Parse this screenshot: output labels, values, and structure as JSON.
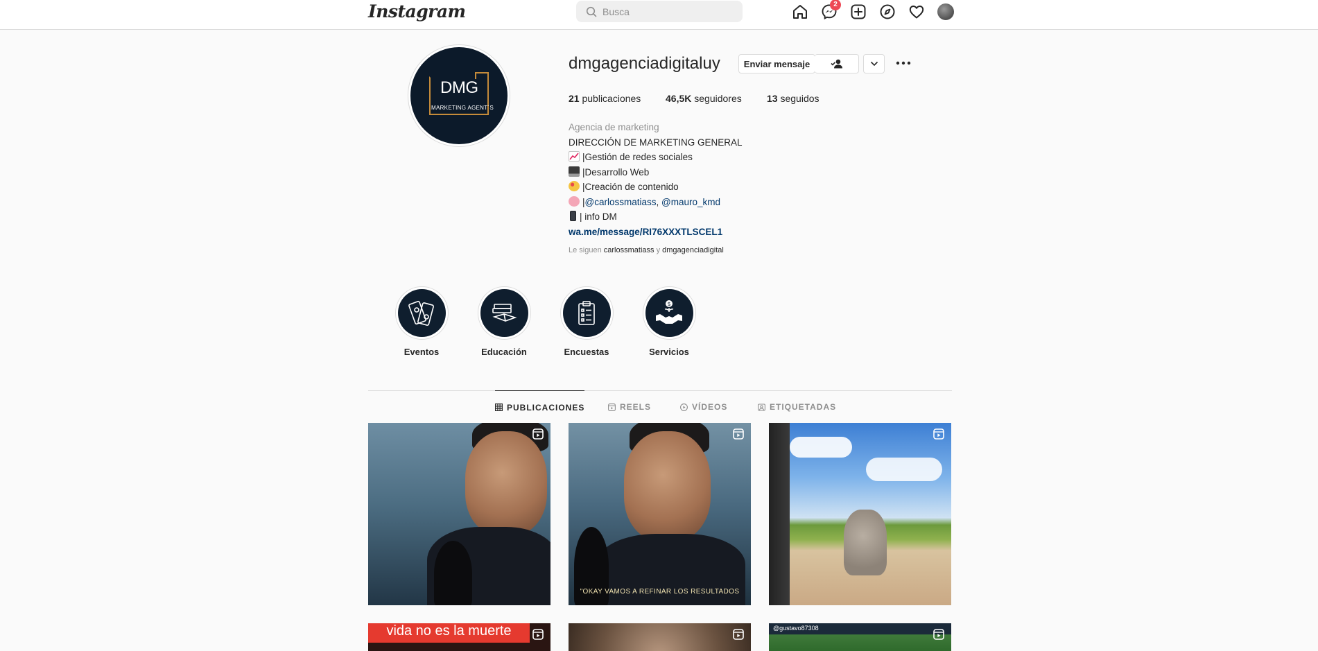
{
  "nav": {
    "logo": "Instagram",
    "search_placeholder": "Busca",
    "messenger_badge": "2"
  },
  "profile": {
    "username": "dmgagenciadigitaluy",
    "send_message": "Enviar mensaje",
    "avatar_text": "DMG",
    "avatar_subtext": "MARKETING AGENT´S",
    "stats": [
      {
        "count": "21",
        "label": "publicaciones"
      },
      {
        "count": "46,5K",
        "label": "seguidores"
      },
      {
        "count": "13",
        "label": "seguidos"
      }
    ],
    "category": "Agencia de marketing",
    "bio": {
      "line1": "DIRECCIÓN DE MARKETING GENERAL",
      "line2": "|Gestión de redes sociales",
      "line3": "|Desarrollo Web",
      "line4": "|Creación de contenido",
      "line5_prefix": "|",
      "line5_mention1": "@carlossmatiass",
      "line5_sep": ", ",
      "line5_mention2": "@mauro_kmd",
      "line6": "| info DM",
      "link": "wa.me/message/RI76XXXTLSCEL1"
    },
    "followed_by": {
      "prefix": "Le siguen ",
      "name1": "carlossmatiass",
      "sep": " y ",
      "name2": "dmgagenciadigital"
    }
  },
  "highlights": [
    {
      "label": "Eventos",
      "icon": "tickets-icon"
    },
    {
      "label": "Educación",
      "icon": "books-icon"
    },
    {
      "label": "Encuestas",
      "icon": "clipboard-icon"
    },
    {
      "label": "Servicios",
      "icon": "handshake-icon"
    }
  ],
  "tabs": [
    {
      "label": "PUBLICACIONES",
      "icon": "grid-icon",
      "active": true
    },
    {
      "label": "REELS",
      "icon": "reels-icon",
      "active": false
    },
    {
      "label": "VÍDEOS",
      "icon": "video-icon",
      "active": false
    },
    {
      "label": "ETIQUETADAS",
      "icon": "tagged-icon",
      "active": false
    }
  ],
  "posts": {
    "post2_caption": "\"OKAY VAMOS A REFINAR LOS RESULTADOS",
    "post4_caption": "vida no es la muerte",
    "post6_caption": "@gustavo87308"
  },
  "colors": {
    "link": "#00376b",
    "badge": "#ed4956",
    "muted": "#8e8e8e",
    "text": "#262626"
  }
}
